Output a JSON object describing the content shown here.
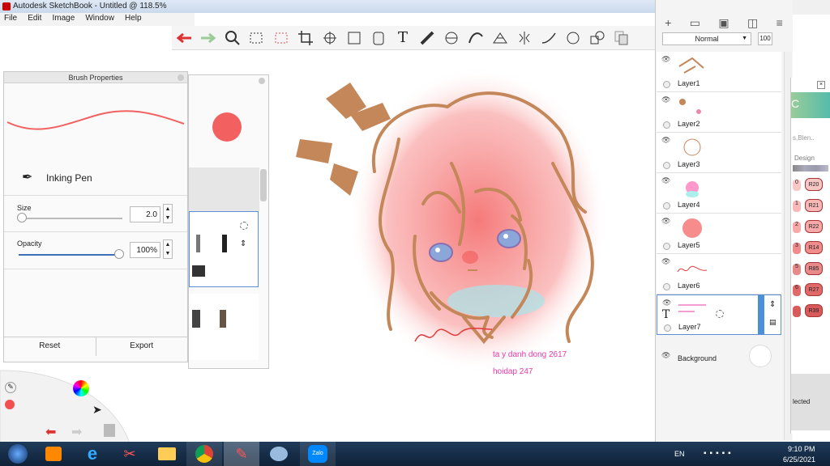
{
  "window": {
    "title": "Autodesk SketchBook - Untitled @ 118.5%"
  },
  "menu": [
    "File",
    "Edit",
    "Image",
    "Window",
    "Help"
  ],
  "toolbar": [
    "undo-icon",
    "redo-icon",
    "zoom-icon",
    "select-icon",
    "lasso-icon",
    "crop-icon",
    "transform-icon",
    "distort-icon",
    "fill-icon",
    "text-icon",
    "ruler-icon",
    "ellipse-guide-icon",
    "french-curve-icon",
    "perspective-icon",
    "symmetry-icon",
    "stroke-icon",
    "circle-icon",
    "shapes-icon",
    "copy-icon"
  ],
  "brush": {
    "panel_title": "Brush Properties",
    "name": "Inking Pen",
    "size_label": "Size",
    "size_value": "2.0",
    "opacity_label": "Opacity",
    "opacity_value": "100%",
    "reset_label": "Reset",
    "export_label": "Export",
    "color": "#f26060"
  },
  "layers": {
    "blend_mode": "Normal",
    "opacity": "100",
    "items": [
      "Layer1",
      "Layer2",
      "Layer3",
      "Layer4",
      "Layer5",
      "Layer6",
      "Layer7"
    ],
    "background_label": "Background",
    "active": "Layer7"
  },
  "canvas": {
    "text1": "ta y danh dong 2617",
    "text2": "hoidap 247",
    "text_color": "#e83aa8"
  },
  "copic": {
    "header": "C",
    "search": "s,Blen..",
    "design": "Design",
    "swatches": [
      "R20",
      "R21",
      "R22",
      "R14",
      "R85",
      "R27",
      "R39"
    ],
    "prefix": [
      "0",
      "1",
      "2",
      "3",
      "5",
      "6",
      ""
    ],
    "selected": "lected"
  },
  "tray": {
    "lang": "EN",
    "time": "9:10 PM",
    "date": "6/25/2021"
  }
}
